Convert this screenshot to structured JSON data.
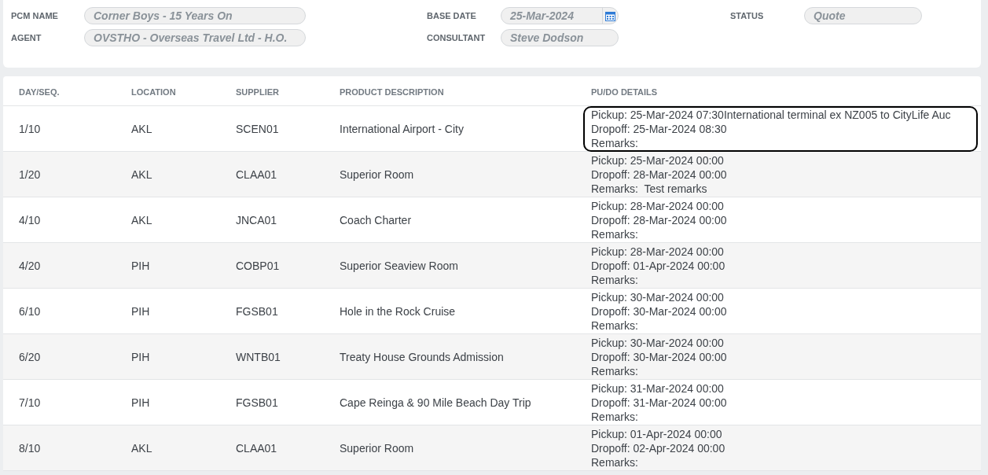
{
  "header": {
    "fields": [
      {
        "label": "PCM NAME",
        "value": "Corner Boys - 15 Years On",
        "kind": "text"
      },
      {
        "label": "BASE DATE",
        "value": "25-Mar-2024",
        "kind": "date"
      },
      {
        "label": "STATUS",
        "value": "Quote",
        "kind": "text"
      },
      {
        "label": "AGENT",
        "value": "OVSTHO - Overseas Travel Ltd - H.O.",
        "kind": "text"
      },
      {
        "label": "CONSULTANT",
        "value": "Steve Dodson",
        "kind": "text"
      }
    ]
  },
  "table": {
    "columns": [
      "DAY/SEQ.",
      "LOCATION",
      "SUPPLIER",
      "PRODUCT DESCRIPTION",
      "PU/DO DETAILS"
    ],
    "rows": [
      {
        "cells": [
          "1/10",
          "AKL",
          "SCEN01",
          "International Airport - City"
        ],
        "details": [
          "Pickup: 25-Mar-2024 07:30International terminal ex NZ005 to CityLife Auc",
          "Dropoff: 25-Mar-2024 08:30",
          "Remarks:"
        ],
        "focused": true
      },
      {
        "cells": [
          "1/20",
          "AKL",
          "CLAA01",
          "Superior Room"
        ],
        "details": [
          "Pickup: 25-Mar-2024 00:00",
          "Dropoff: 28-Mar-2024 00:00",
          "Remarks:  Test remarks"
        ],
        "focused": false
      },
      {
        "cells": [
          "4/10",
          "AKL",
          "JNCA01",
          "Coach Charter"
        ],
        "details": [
          "Pickup: 28-Mar-2024 00:00",
          "Dropoff: 28-Mar-2024 00:00",
          "Remarks:"
        ],
        "focused": false
      },
      {
        "cells": [
          "4/20",
          "PIH",
          "COBP01",
          "Superior Seaview Room"
        ],
        "details": [
          "Pickup: 28-Mar-2024 00:00",
          "Dropoff: 01-Apr-2024 00:00",
          "Remarks:"
        ],
        "focused": false
      },
      {
        "cells": [
          "6/10",
          "PIH",
          "FGSB01",
          "Hole in the Rock Cruise"
        ],
        "details": [
          "Pickup: 30-Mar-2024 00:00",
          "Dropoff: 30-Mar-2024 00:00",
          "Remarks:"
        ],
        "focused": false
      },
      {
        "cells": [
          "6/20",
          "PIH",
          "WNTB01",
          "Treaty House Grounds Admission"
        ],
        "details": [
          "Pickup: 30-Mar-2024 00:00",
          "Dropoff: 30-Mar-2024 00:00",
          "Remarks:"
        ],
        "focused": false
      },
      {
        "cells": [
          "7/10",
          "PIH",
          "FGSB01",
          "Cape Reinga & 90 Mile Beach Day Trip"
        ],
        "details": [
          "Pickup: 31-Mar-2024 00:00",
          "Dropoff: 31-Mar-2024 00:00",
          "Remarks:"
        ],
        "focused": false
      },
      {
        "cells": [
          "8/10",
          "AKL",
          "CLAA01",
          "Superior Room"
        ],
        "details": [
          "Pickup: 01-Apr-2024 00:00",
          "Dropoff: 02-Apr-2024 00:00",
          "Remarks:"
        ],
        "focused": false
      }
    ]
  }
}
